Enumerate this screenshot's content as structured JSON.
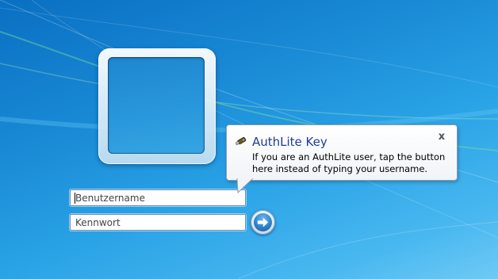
{
  "login": {
    "username_placeholder": "Benutzername",
    "password_placeholder": "Kennwort"
  },
  "tooltip": {
    "title": "AuthLite Key",
    "body": "If you are an AuthLite user, tap the button here instead of typing your username.",
    "close_label": "x",
    "icon": "usb-key-icon"
  },
  "colors": {
    "background": "#1a8bd6",
    "tooltip_title": "#1d3f8f"
  }
}
